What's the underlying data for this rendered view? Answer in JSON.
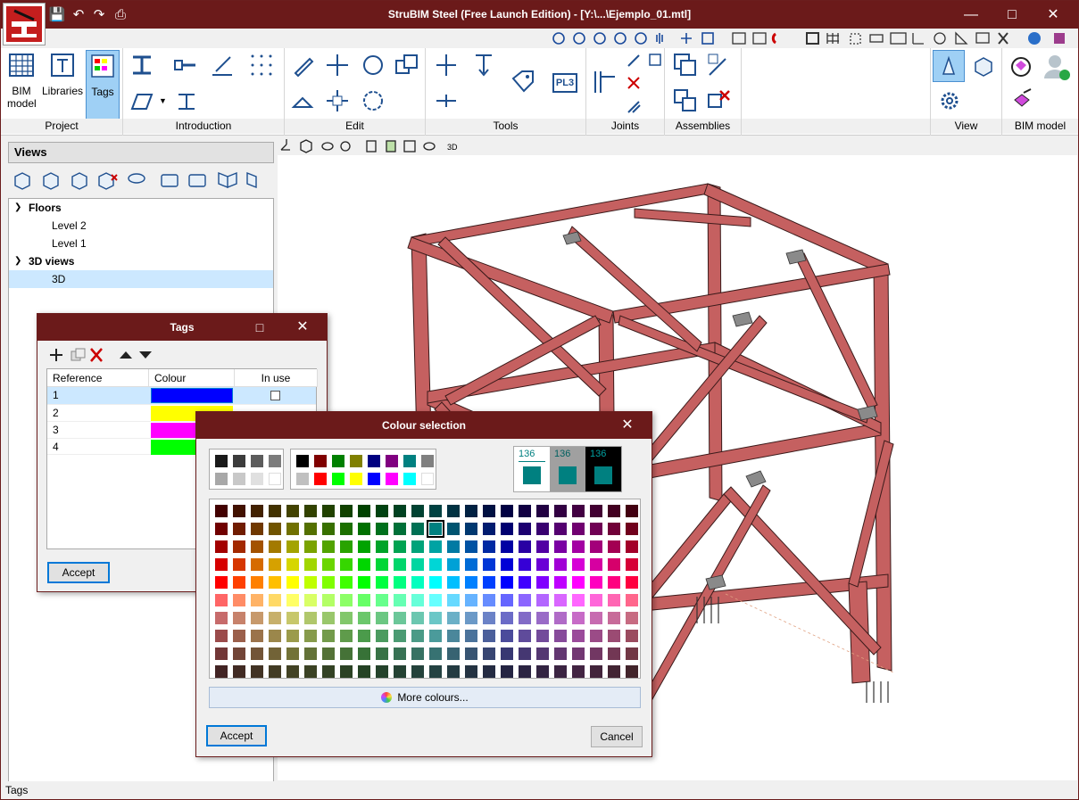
{
  "window": {
    "title": "StruBIM Steel (Free Launch Edition) - [Y:\\...\\Ejemplo_01.mtl]"
  },
  "ribbon": {
    "bim_model_label": "BIM model",
    "libraries_label": "Libraries",
    "tags_label": "Tags",
    "groups": [
      "Project",
      "Introduction",
      "Edit",
      "Tools",
      "Joints",
      "Assemblies",
      "View",
      "BIM model"
    ],
    "pl3_label": "PL3"
  },
  "left_panel": {
    "title": "Views",
    "tree": [
      {
        "label": "Floors",
        "level": 0,
        "bold": true
      },
      {
        "label": "Level 2",
        "level": 1
      },
      {
        "label": "Level 1",
        "level": 1
      },
      {
        "label": "3D views",
        "level": 0,
        "bold": true
      },
      {
        "label": "3D",
        "level": 1,
        "selected": true
      }
    ]
  },
  "viewport": {
    "toolbar_3d_label": "3D"
  },
  "tags_dialog": {
    "title": "Tags",
    "columns": [
      "Reference",
      "Colour",
      "In use"
    ],
    "rows": [
      {
        "reference": "1",
        "colour": "#0000ff"
      },
      {
        "reference": "2",
        "colour": "#ffff00"
      },
      {
        "reference": "3",
        "colour": "#ff00ff"
      },
      {
        "reference": "4",
        "colour": "#00ff00"
      }
    ],
    "accept_label": "Accept"
  },
  "colour_dialog": {
    "title": "Colour selection",
    "gray_swatches": [
      "#1a1a1a",
      "#3c3c3c",
      "#5c5c5c",
      "#7c7c7c",
      "#a8a8a8",
      "#c8c8c8",
      "#e0e0e0",
      "#ffffff"
    ],
    "basic_swatches": [
      "#000000",
      "#800000",
      "#008000",
      "#808000",
      "#000080",
      "#800080",
      "#008080",
      "#808080",
      "#c0c0c0",
      "#ff0000",
      "#00ff00",
      "#ffff00",
      "#0000ff",
      "#ff00ff",
      "#00ffff",
      "#ffffff"
    ],
    "preview_value": "136",
    "preview_color": "#008080",
    "more_colours_label": "More colours...",
    "accept_label": "Accept",
    "cancel_label": "Cancel"
  },
  "status": {
    "text": "Tags"
  },
  "colors": {
    "titlebar": "#6b1a1a",
    "steel": "#c56060",
    "accent": "#0078d7"
  }
}
